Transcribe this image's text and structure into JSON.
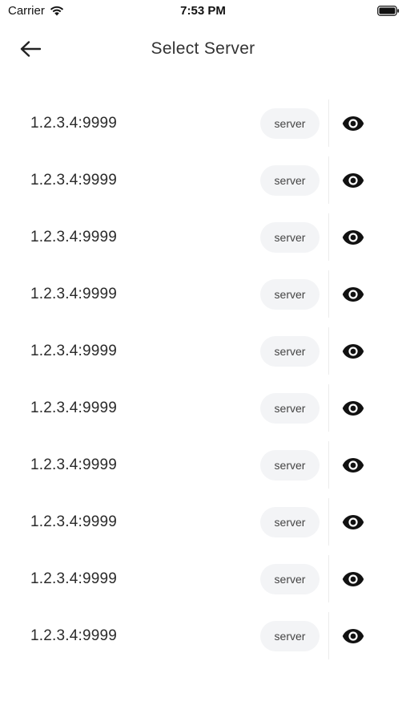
{
  "status_bar": {
    "carrier": "Carrier",
    "time": "7:53 PM"
  },
  "header": {
    "title": "Select Server",
    "back_icon": "arrow-left-icon"
  },
  "servers": [
    {
      "address": "1.2.3.4:9999",
      "tag": "server"
    },
    {
      "address": "1.2.3.4:9999",
      "tag": "server"
    },
    {
      "address": "1.2.3.4:9999",
      "tag": "server"
    },
    {
      "address": "1.2.3.4:9999",
      "tag": "server"
    },
    {
      "address": "1.2.3.4:9999",
      "tag": "server"
    },
    {
      "address": "1.2.3.4:9999",
      "tag": "server"
    },
    {
      "address": "1.2.3.4:9999",
      "tag": "server"
    },
    {
      "address": "1.2.3.4:9999",
      "tag": "server"
    },
    {
      "address": "1.2.3.4:9999",
      "tag": "server"
    },
    {
      "address": "1.2.3.4:9999",
      "tag": "server"
    }
  ],
  "icons": {
    "view": "eye-icon",
    "wifi": "wifi-icon",
    "battery": "battery-icon"
  },
  "colors": {
    "chip_background": "#f3f4f6",
    "text": "#2b2b2b",
    "icon": "#111111"
  }
}
